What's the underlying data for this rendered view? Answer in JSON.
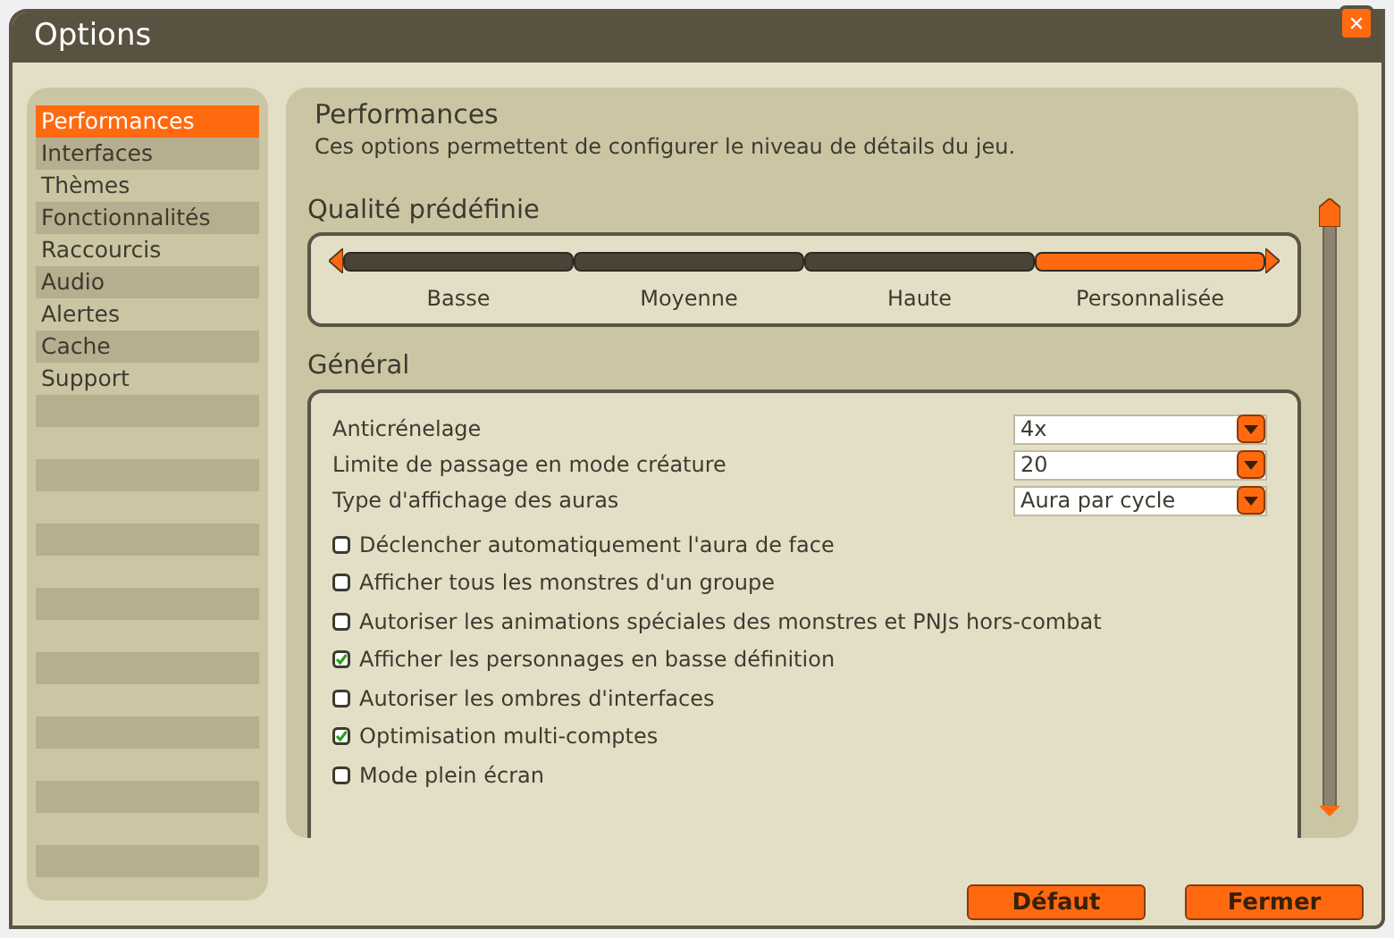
{
  "window": {
    "title": "Options",
    "close_label": "✕"
  },
  "sidebar": {
    "items": [
      {
        "label": "Performances",
        "selected": true
      },
      {
        "label": "Interfaces",
        "selected": false
      },
      {
        "label": "Thèmes",
        "selected": false
      },
      {
        "label": "Fonctionnalités",
        "selected": false
      },
      {
        "label": "Raccourcis",
        "selected": false
      },
      {
        "label": "Audio",
        "selected": false
      },
      {
        "label": "Alertes",
        "selected": false
      },
      {
        "label": "Cache",
        "selected": false
      },
      {
        "label": "Support",
        "selected": false
      }
    ]
  },
  "page": {
    "title": "Performances",
    "description": "Ces options permettent de configurer le niveau de détails du jeu."
  },
  "preset": {
    "title": "Qualité prédéfinie",
    "options": [
      {
        "label": "Basse",
        "selected": false
      },
      {
        "label": "Moyenne",
        "selected": false
      },
      {
        "label": "Haute",
        "selected": false
      },
      {
        "label": "Personnalisée",
        "selected": true
      }
    ]
  },
  "general": {
    "title": "Général",
    "dropdowns": [
      {
        "label": "Anticrénelage",
        "value": "4x"
      },
      {
        "label": "Limite de passage en mode créature",
        "value": "20"
      },
      {
        "label": "Type d'affichage des auras",
        "value": "Aura par cycle"
      }
    ],
    "checkboxes": [
      {
        "label": "Déclencher automatiquement l'aura de face",
        "checked": false
      },
      {
        "label": "Afficher tous les monstres d'un groupe",
        "checked": false
      },
      {
        "label": "Autoriser les animations spéciales des monstres et PNJs hors-combat",
        "checked": false
      },
      {
        "label": "Afficher les personnages en basse définition",
        "checked": true
      },
      {
        "label": "Autoriser les ombres d'interfaces",
        "checked": false
      },
      {
        "label": "Optimisation multi-comptes",
        "checked": true
      },
      {
        "label": "Mode plein écran",
        "checked": false
      }
    ]
  },
  "buttons": [
    "Défaut",
    "Fermer"
  ]
}
